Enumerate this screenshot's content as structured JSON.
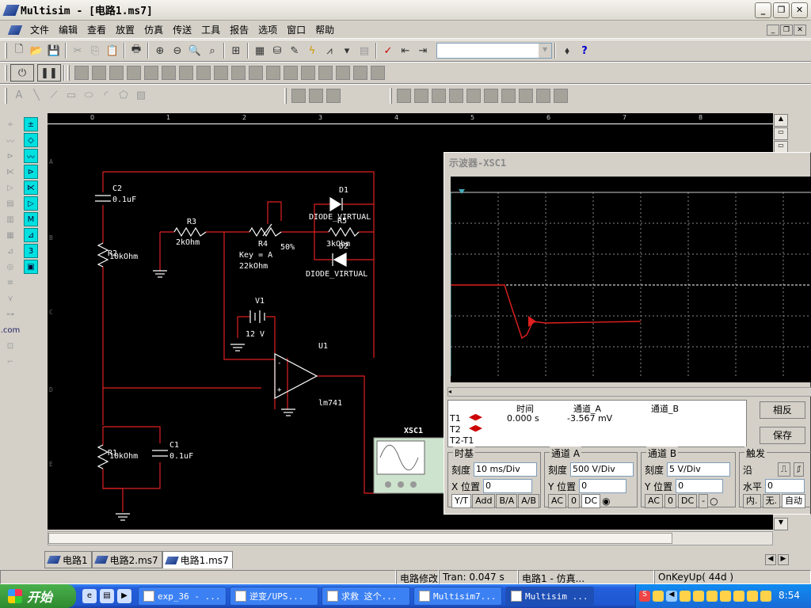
{
  "window": {
    "title": "Multisim - [电路1.ms7]"
  },
  "menu": [
    "文件",
    "编辑",
    "查看",
    "放置",
    "仿真",
    "传送",
    "工具",
    "报告",
    "选项",
    "窗口",
    "帮助"
  ],
  "ruler": {
    "ticks": [
      "0",
      "1",
      "2",
      "3",
      "4",
      "5",
      "6",
      "7",
      "8"
    ],
    "side": [
      "A",
      "B",
      "C",
      "D",
      "E"
    ]
  },
  "schematic": {
    "labels": {
      "c2": "C2",
      "c2v": "0.1uF",
      "r2": "R2",
      "r2v": "10kOhm",
      "r3": "R3",
      "r3v": "2kOhm",
      "r4": "R4",
      "r4pct": "50%",
      "r4key": "Key = A",
      "r4v": "22kOhm",
      "d1": "D1",
      "d1v": "DIODE_VIRTUAL",
      "r5": "R5",
      "r5v": "3kOhm",
      "d2": "D2",
      "d2v": "DIODE_VIRTUAL",
      "v1": "V1",
      "v1v": "12 V",
      "u1": "U1",
      "u1v": "lm741",
      "r1": "R1",
      "r1v": "10kOhm",
      "c1": "C1",
      "c1v": "0.1uF",
      "xsc": "XSC1"
    }
  },
  "scope": {
    "title": "示波器-XSC1",
    "info": {
      "h_time": "时间",
      "h_a": "通道_A",
      "h_b": "通道_B",
      "t1": "T1",
      "t2": "T2",
      "t21": "T2-T1",
      "time": "0.000 s",
      "va": "-3.567 mV"
    },
    "buttons": {
      "reverse": "相反",
      "save": "保存"
    },
    "timebase": {
      "title": "时基",
      "scale_lbl": "刻度",
      "scale": "10 ms/Div",
      "xpos_lbl": "X 位置",
      "xpos": "0",
      "yt": "Y/T",
      "add": "Add",
      "ba": "B/A",
      "ab": "A/B"
    },
    "cha": {
      "title": "通道 A",
      "scale_lbl": "刻度",
      "scale": "500  V/Div",
      "ypos_lbl": "Y 位置",
      "ypos": "0",
      "ac": "AC",
      "zero": "0",
      "dc": "DC"
    },
    "chb": {
      "title": "通道 B",
      "scale_lbl": "刻度",
      "scale": "5  V/Div",
      "ypos_lbl": "Y 位置",
      "ypos": "0",
      "ac": "AC",
      "zero": "0",
      "dc": "DC",
      "minus": "-"
    },
    "trigger": {
      "title": "触发",
      "edge_lbl": "沿",
      "level_lbl": "水平",
      "level": "0",
      "inner": "内.",
      "none": "无.",
      "auto": "自动"
    }
  },
  "tabs": [
    "电路1",
    "电路2.ms7",
    "电路1.ms7"
  ],
  "status": [
    "",
    "电路修改",
    "Tran: 0.047 s",
    "电路1 - 仿真...",
    "OnKeyUp( 44d )"
  ],
  "taskbar": {
    "start": "开始",
    "items": [
      "exp_36 - ...",
      "逆变/UPS...",
      "求救 这个...",
      "Multisim7...",
      "Multisim ..."
    ],
    "clock": "8:54"
  }
}
